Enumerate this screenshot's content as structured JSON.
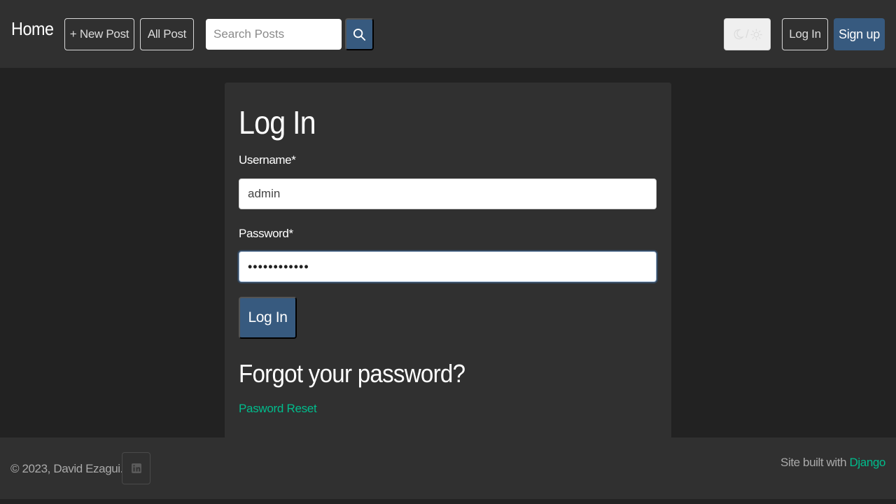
{
  "navbar": {
    "brand": "Home",
    "new_post_label": "+ New Post",
    "all_post_label": "All Post",
    "search_placeholder": "Search Posts",
    "search_icon": "search-icon",
    "theme_toggle_separator": "/",
    "theme_icons": [
      "moon-icon",
      "sun-icon"
    ],
    "login_label": "Log In",
    "signup_label": "Sign up"
  },
  "login_form": {
    "title": "Log In",
    "username_label": "Username*",
    "username_value": "admin",
    "password_label": "Password*",
    "password_value": "••••••••••••",
    "submit_label": "Log In",
    "forgot_title": "Forgot your password?",
    "reset_link_label": "Pasword Reset"
  },
  "footer": {
    "copyright": "© 2023, David Ezagui.",
    "social_icon": "linkedin-icon",
    "built_with_text": "Site built with ",
    "django_link": "Django"
  },
  "colors": {
    "background": "#222222",
    "surface": "#303030",
    "primary": "#375a7f",
    "link": "#00bc8c",
    "muted_text": "#aaaaaa"
  }
}
